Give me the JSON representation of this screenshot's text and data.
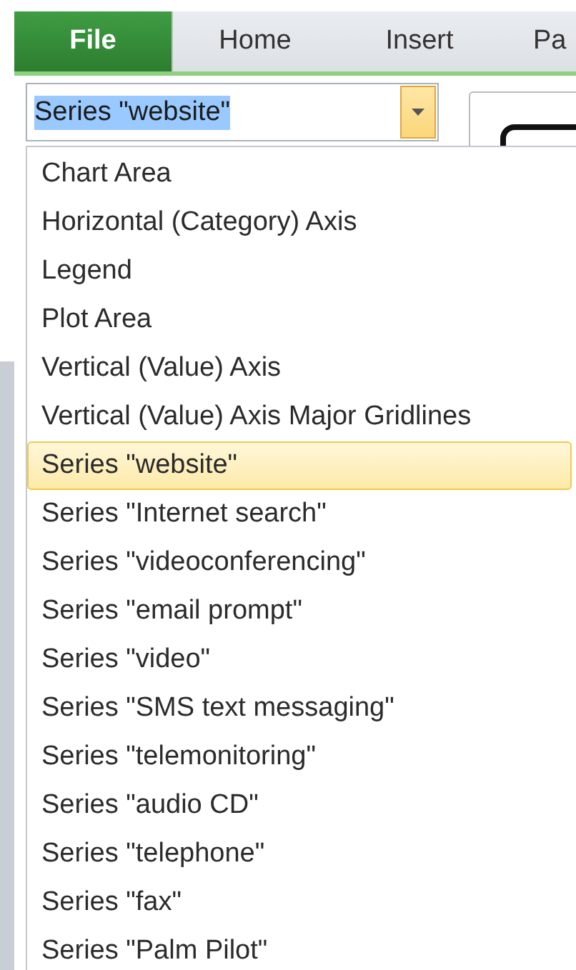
{
  "tabs": [
    {
      "label": "File",
      "selected": true
    },
    {
      "label": "Home",
      "selected": false
    },
    {
      "label": "Insert",
      "selected": false
    },
    {
      "label": "Pa",
      "selected": false
    }
  ],
  "element_selector": {
    "value": "Series \"website\"",
    "text_selected": true,
    "open": true
  },
  "dropdown_items": [
    {
      "label": "Chart Area",
      "selected": false
    },
    {
      "label": "Horizontal (Category) Axis",
      "selected": false
    },
    {
      "label": "Legend",
      "selected": false
    },
    {
      "label": "Plot Area",
      "selected": false
    },
    {
      "label": "Vertical (Value) Axis",
      "selected": false
    },
    {
      "label": "Vertical (Value) Axis Major Gridlines",
      "selected": false
    },
    {
      "label": "Series \"website\"",
      "selected": true
    },
    {
      "label": "Series \"Internet search\"",
      "selected": false
    },
    {
      "label": "Series \"videoconferencing\"",
      "selected": false
    },
    {
      "label": "Series \"email prompt\"",
      "selected": false
    },
    {
      "label": "Series \"video\"",
      "selected": false
    },
    {
      "label": "Series \"SMS text messaging\"",
      "selected": false
    },
    {
      "label": "Series \"telemonitoring\"",
      "selected": false
    },
    {
      "label": "Series \"audio CD\"",
      "selected": false
    },
    {
      "label": "Series \"telephone\"",
      "selected": false
    },
    {
      "label": "Series \"fax\"",
      "selected": false
    },
    {
      "label": "Series \"Palm Pilot\"",
      "selected": false
    }
  ]
}
